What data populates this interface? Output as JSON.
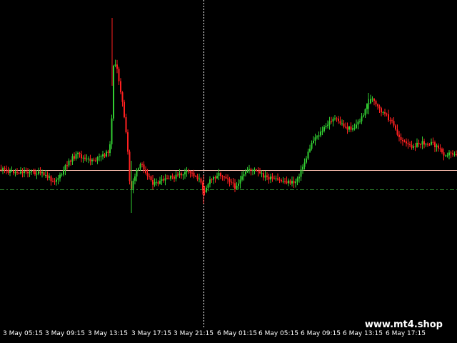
{
  "colors": {
    "background": "#000000",
    "bull_candle": "#32cd32",
    "bear_candle": "#ff2020",
    "price_line": "#ffc0b0",
    "level_line": "#2e8b2e",
    "crosshair": "#ffffff",
    "axis_text": "#ffffff"
  },
  "time_axis": {
    "labels": [
      "3 May 05:15",
      "3 May 09:15",
      "3 May 13:15",
      "3 May 17:15",
      "3 May 21:15",
      "6 May 01:15",
      "6 May 05:15",
      "6 May 09:15",
      "6 May 13:15",
      "6 May 17:15"
    ]
  },
  "watermark": "www.mt4.shop"
}
